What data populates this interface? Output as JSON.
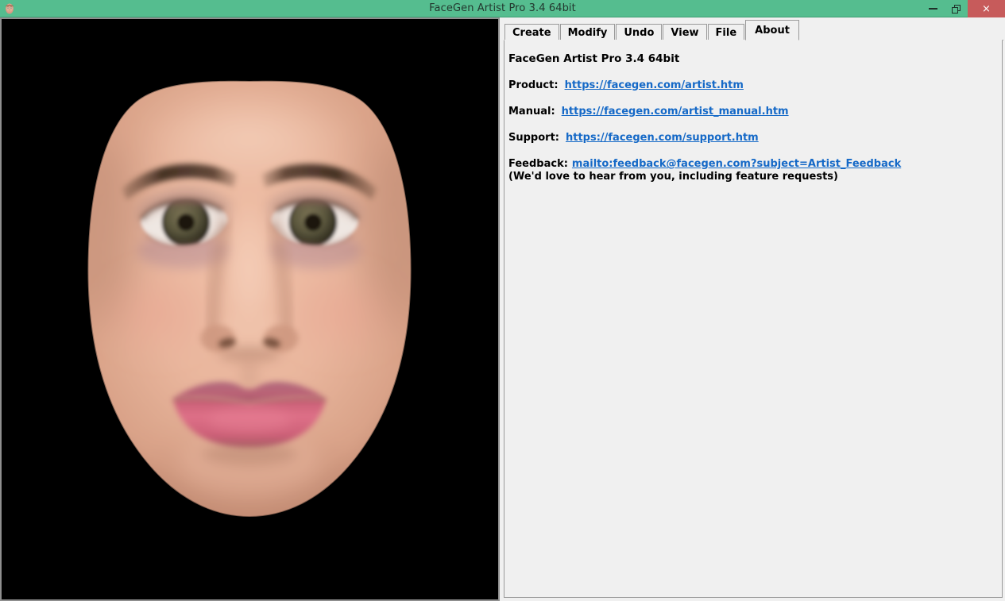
{
  "window": {
    "title": "FaceGen Artist Pro 3.4 64bit",
    "icon": "face-icon",
    "controls": {
      "minimize": "minimize-icon",
      "restore": "restore-icon",
      "close": "×"
    },
    "accent_color": "#55bd8f",
    "close_color": "#c75b5b"
  },
  "viewport": {
    "name": "3d-face-viewport",
    "background_color": "#000000",
    "model": {
      "subject": "female-head-frontal",
      "skin_color": "#e8b49c",
      "skin_shadow_color": "#b78268",
      "lip_color": "#c9607a",
      "iris_color": "#54523a",
      "brow_color": "#4a3125",
      "sclera_color": "#f2ece8"
    }
  },
  "tabs": {
    "items": [
      {
        "id": "create",
        "label": "Create",
        "active": false
      },
      {
        "id": "modify",
        "label": "Modify",
        "active": false
      },
      {
        "id": "undo",
        "label": "Undo",
        "active": false
      },
      {
        "id": "view",
        "label": "View",
        "active": false
      },
      {
        "id": "file",
        "label": "File",
        "active": false
      },
      {
        "id": "about",
        "label": "About",
        "active": true
      }
    ]
  },
  "about": {
    "heading": "FaceGen Artist Pro 3.4 64bit",
    "links": [
      {
        "id": "product",
        "label": "Product:",
        "url": "https://facegen.com/artist.htm"
      },
      {
        "id": "manual",
        "label": "Manual:",
        "url": "https://facegen.com/artist_manual.htm"
      },
      {
        "id": "support",
        "label": "Support:",
        "url": "https://facegen.com/support.htm"
      }
    ],
    "feedback": {
      "label": "Feedback:",
      "url": "mailto:feedback@facegen.com?subject=Artist_Feedback",
      "note": "(We'd love to hear from you, including feature requests)"
    },
    "link_color": "#1569c7"
  }
}
